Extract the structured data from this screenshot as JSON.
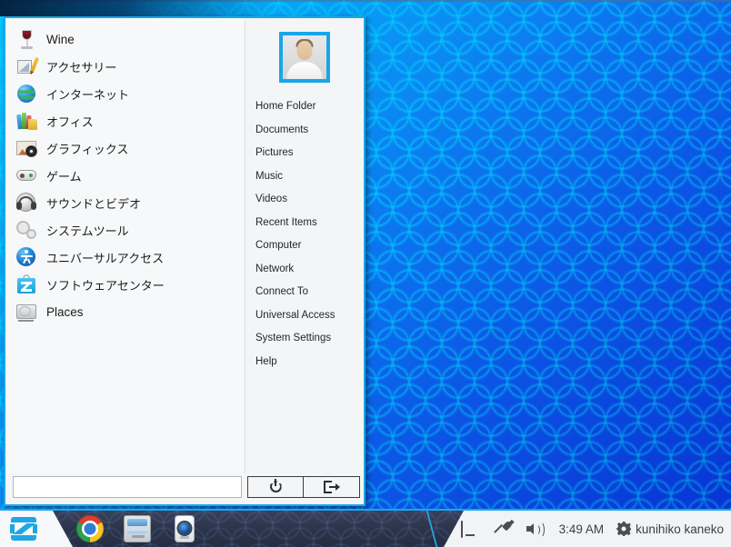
{
  "desktop": {
    "wallpaper_name": "zorin-hexagon-blue-wallpaper",
    "accent_color": "#1ea7e6",
    "taskbar_bg": "#2b3449",
    "tray_panel_bg": "#f2f3f4"
  },
  "menu": {
    "categories": [
      {
        "label": "Wine",
        "icon": "wine-glass-icon",
        "jp": false
      },
      {
        "label": "アクセサリー",
        "icon": "accessories-icon",
        "jp": true
      },
      {
        "label": "インターネット",
        "icon": "internet-globe-icon",
        "jp": true
      },
      {
        "label": "オフィス",
        "icon": "office-books-icon",
        "jp": true
      },
      {
        "label": "グラフィックス",
        "icon": "graphics-image-icon",
        "jp": true
      },
      {
        "label": "ゲーム",
        "icon": "games-controller-icon",
        "jp": true
      },
      {
        "label": "サウンドとビデオ",
        "icon": "sound-headphones-icon",
        "jp": true
      },
      {
        "label": "システムツール",
        "icon": "system-gears-icon",
        "jp": true
      },
      {
        "label": "ユニバーサルアクセス",
        "icon": "universal-access-icon",
        "jp": true
      },
      {
        "label": "ソフトウェアセンター",
        "icon": "software-center-icon",
        "jp": true
      },
      {
        "label": "Places",
        "icon": "places-harddisk-icon",
        "jp": false
      }
    ],
    "avatar": {
      "name": "user-avatar",
      "border_color": "#18a6e8"
    },
    "places": [
      "Home Folder",
      "Documents",
      "Pictures",
      "Music",
      "Videos",
      "Recent Items",
      "Computer",
      "Network",
      "Connect To",
      "Universal Access",
      "System Settings",
      "Help"
    ],
    "search": {
      "value": "",
      "placeholder": ""
    },
    "footer_buttons": [
      {
        "label": "",
        "icon": "power-icon",
        "name": "shutdown-button"
      },
      {
        "label": "",
        "icon": "logout-icon",
        "name": "logout-button"
      }
    ]
  },
  "taskbar": {
    "start_button": {
      "name": "zorin-menu-button",
      "icon": "zorin-logo-icon"
    },
    "launchers": [
      {
        "name": "launcher-chrome",
        "icon": "google-chrome-icon"
      },
      {
        "name": "launcher-file-manager",
        "icon": "file-manager-icon"
      },
      {
        "name": "launcher-webcam",
        "icon": "webcam-icon"
      }
    ],
    "tray": {
      "icons": [
        {
          "name": "keyboard-layout-icon",
          "icon": "keyboard-icon"
        },
        {
          "name": "network-plug-icon",
          "icon": "plug-icon"
        },
        {
          "name": "volume-icon",
          "icon": "speaker-icon"
        }
      ],
      "clock": "3:49 AM",
      "user_name": "kunihiko kaneko",
      "user_icon": "gear-icon"
    }
  }
}
